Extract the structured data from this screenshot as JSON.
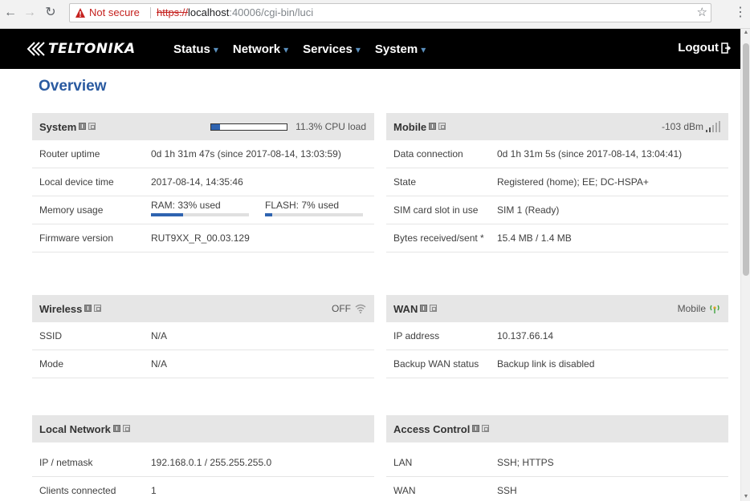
{
  "browser": {
    "not_secure": "Not secure",
    "url_scheme": "https://",
    "url_host": "localhost",
    "url_path": ":40006/cgi-bin/luci",
    "back_icon": "back-arrow-icon",
    "forward_icon": "forward-arrow-icon",
    "reload_icon": "reload-icon"
  },
  "header": {
    "brand": "TELTONIKA",
    "nav": [
      {
        "label": "Status"
      },
      {
        "label": "Network"
      },
      {
        "label": "Services"
      },
      {
        "label": "System"
      }
    ],
    "logout": "Logout"
  },
  "page": {
    "title": "Overview"
  },
  "colors": {
    "accent": "#2a5aa0",
    "bar": "#2e63b0",
    "header_bg": "#000000",
    "panel_head": "#e6e6e6"
  },
  "panels": {
    "system": {
      "title": "System",
      "cpu_load": 0.113,
      "cpu_text": "11.3% CPU load",
      "rows": [
        {
          "label": "Router uptime",
          "value": "0d 1h 31m 47s (since 2017-08-14, 13:03:59)"
        },
        {
          "label": "Local device time",
          "value": "2017-08-14, 14:35:46"
        },
        {
          "label": "Memory usage",
          "ram_text": "RAM: 33% used",
          "ram": 0.33,
          "flash_text": "FLASH: 7% used",
          "flash": 0.07
        },
        {
          "label": "Firmware version",
          "value": "RUT9XX_R_00.03.129"
        }
      ]
    },
    "mobile": {
      "title": "Mobile",
      "signal": "-103 dBm",
      "rows": [
        {
          "label": "Data connection",
          "value": "0d 1h 31m 5s (since 2017-08-14, 13:04:41)"
        },
        {
          "label": "State",
          "value": "Registered (home); EE; DC-HSPA+"
        },
        {
          "label": "SIM card slot in use",
          "value": "SIM 1 (Ready)"
        },
        {
          "label": "Bytes received/sent *",
          "value": "15.4 MB / 1.4 MB"
        }
      ]
    },
    "wireless": {
      "title": "Wireless",
      "status": "OFF",
      "rows": [
        {
          "label": "SSID",
          "value": "N/A"
        },
        {
          "label": "Mode",
          "value": "N/A"
        }
      ]
    },
    "wan": {
      "title": "WAN",
      "status": "Mobile",
      "rows": [
        {
          "label": "IP address",
          "value": "10.137.66.14"
        },
        {
          "label": "Backup WAN status",
          "value": "Backup link is disabled"
        }
      ]
    },
    "local_network": {
      "title": "Local Network",
      "rows": [
        {
          "label": "IP / netmask",
          "value": "192.168.0.1 / 255.255.255.0"
        },
        {
          "label": "Clients connected",
          "value": "1"
        }
      ]
    },
    "access_control": {
      "title": "Access Control",
      "rows": [
        {
          "label": "LAN",
          "value": "SSH; HTTPS"
        },
        {
          "label": "WAN",
          "value": "SSH"
        }
      ]
    }
  }
}
